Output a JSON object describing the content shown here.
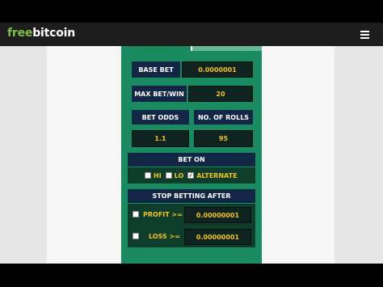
{
  "brand": {
    "part1": "free",
    "part2": "bitcoin"
  },
  "icons": {
    "menu": "hamburger-menu-icon",
    "checkmark": "checkmark-icon"
  },
  "colors": {
    "brand_green": "#7bc043",
    "panel_green": "#1a8a61",
    "navy": "#122745",
    "value_yellow": "#f3c31b"
  },
  "form": {
    "base_bet": {
      "label": "BASE BET",
      "value": "0.0000001"
    },
    "max_bet_win": {
      "label": "MAX BET/WIN",
      "value": "20"
    },
    "bet_odds": {
      "label": "BET ODDS",
      "value": "1.1"
    },
    "no_of_rolls": {
      "label": "NO. OF ROLLS",
      "value": "95"
    },
    "bet_on": {
      "title": "BET ON",
      "options": [
        {
          "label": "HI",
          "checked": false
        },
        {
          "label": "LO",
          "checked": false
        },
        {
          "label": "ALTERNATE",
          "checked": true
        }
      ]
    },
    "stop_betting": {
      "title": "STOP BETTING AFTER",
      "profit": {
        "label": "PROFIT >=",
        "value": "0.00000001"
      },
      "loss": {
        "label": "LOSS >=",
        "value": "0.00000001"
      }
    }
  }
}
